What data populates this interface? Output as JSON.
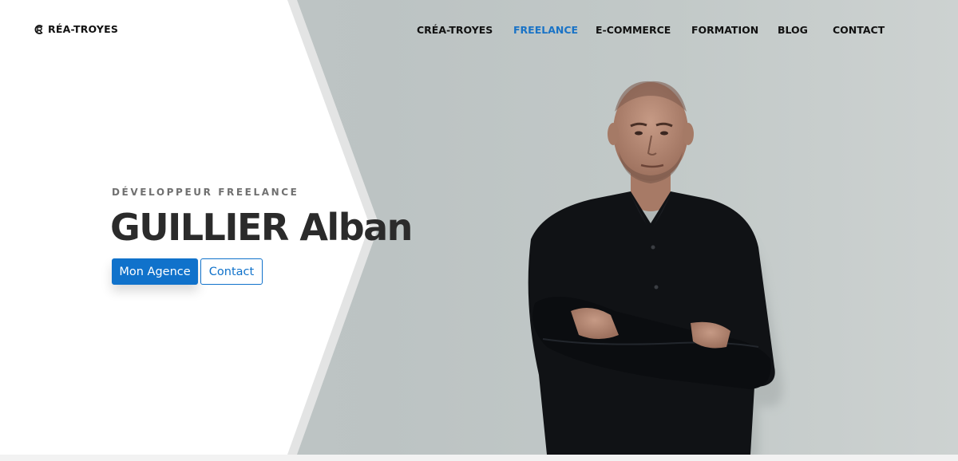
{
  "brand": {
    "logo_icon": "cr-logo-mark",
    "name": "RÉA-TROYES"
  },
  "nav": {
    "items": [
      {
        "label": "CRÉA-TROYES",
        "active": false
      },
      {
        "label": "FREELANCE",
        "active": true
      },
      {
        "label": "E-COMMERCE",
        "active": false
      },
      {
        "label": "FORMATION",
        "active": false
      },
      {
        "label": "BLOG",
        "active": false
      },
      {
        "label": "CONTACT",
        "active": false
      }
    ]
  },
  "hero": {
    "eyebrow": "DÉVELOPPEUR FREELANCE",
    "title": "GUILLIER Alban",
    "buttons": {
      "primary": "Mon Agence",
      "secondary": "Contact"
    },
    "photo": "portrait-photo"
  },
  "colors": {
    "accent": "#1072cb",
    "nav_active": "#1a73c6",
    "title": "#2b2b2b",
    "eyebrow": "#707070",
    "hero_bg": "#bfc5c5"
  }
}
